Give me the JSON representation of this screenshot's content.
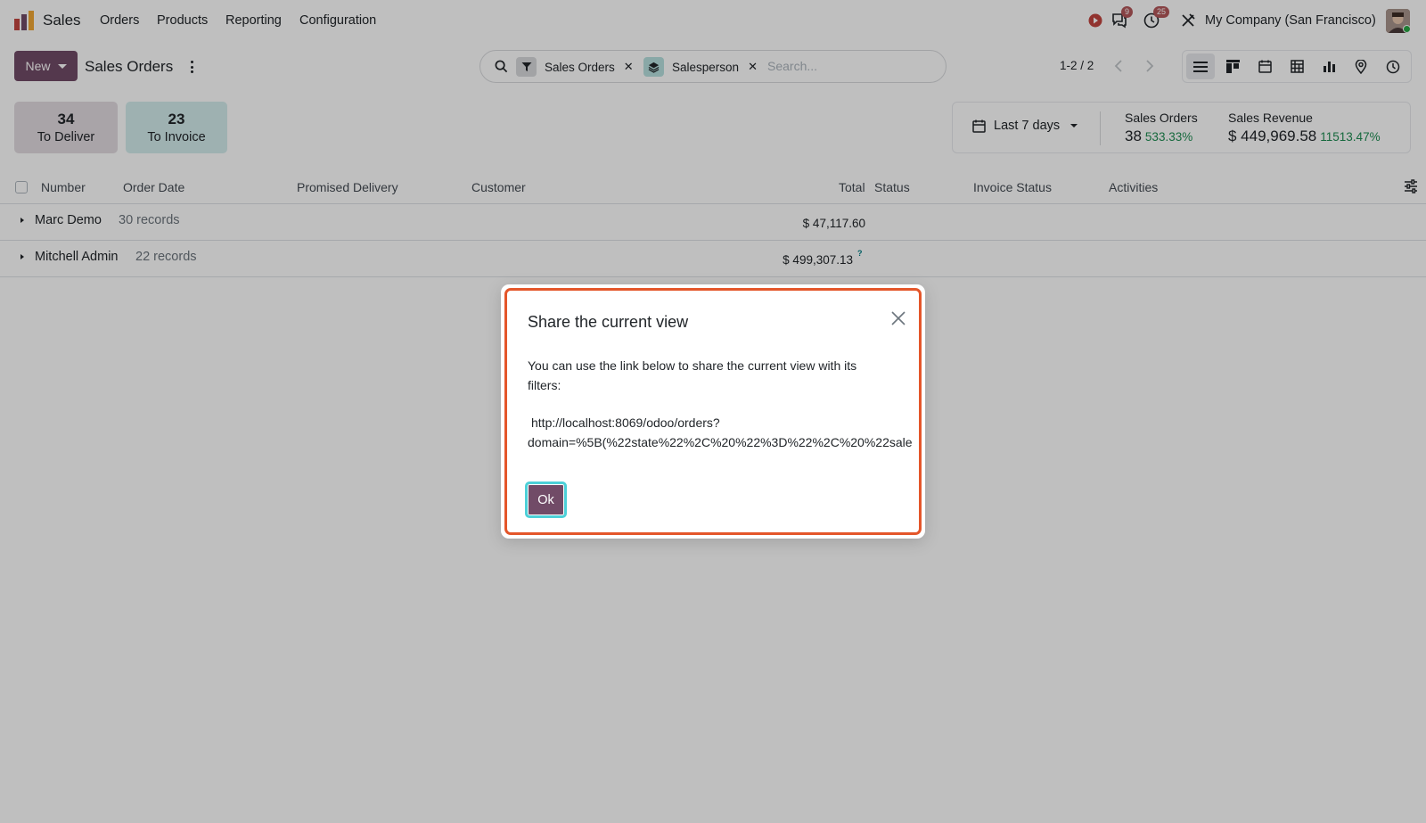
{
  "topbar": {
    "app_name": "Sales",
    "menu": [
      "Orders",
      "Products",
      "Reporting",
      "Configuration"
    ],
    "messages_badge": "9",
    "activities_badge": "25",
    "company": "My Company (San Francisco)"
  },
  "control_panel": {
    "new_label": "New",
    "title": "Sales Orders",
    "facets": [
      {
        "icon": "filter-icon",
        "label": "Sales Orders"
      },
      {
        "icon": "layers-icon",
        "label": "Salesperson"
      }
    ],
    "search_placeholder": "Search...",
    "pager": "1-2 / 2",
    "views": [
      "list-view-icon",
      "kanban-view-icon",
      "calendar-view-icon",
      "pivot-view-icon",
      "graph-view-icon",
      "map-view-icon",
      "activity-view-icon"
    ]
  },
  "tiles": [
    {
      "count": "34",
      "label": "To Deliver"
    },
    {
      "count": "23",
      "label": "To Invoice"
    }
  ],
  "kpis": {
    "period": "Last 7 days",
    "sales_orders_label": "Sales Orders",
    "sales_orders_value": "38",
    "sales_orders_delta": "533.33%",
    "revenue_label": "Sales Revenue",
    "revenue_value": "$ 449,969.58",
    "revenue_delta": "11513.47%"
  },
  "table": {
    "columns": [
      "Number",
      "Order Date",
      "Promised Delivery",
      "Customer",
      "Total",
      "Status",
      "Invoice Status",
      "Activities"
    ],
    "groups": [
      {
        "name": "Marc Demo",
        "count": "30 records",
        "total": "$ 47,117.60"
      },
      {
        "name": "Mitchell Admin",
        "count": "22 records",
        "total": "$ 499,307.13",
        "help": "?"
      }
    ]
  },
  "dialog": {
    "title": "Share the current view",
    "text": "You can use the link below to share the current view with its filters:",
    "link_line1": "http://localhost:8069/odoo/orders?",
    "link_line2": "domain=%5B(%22state%22%2C%20%22%3D%22%2C%20%22sale",
    "ok_label": "Ok"
  },
  "colors": {
    "brand": "#714b67",
    "accent": "#017e84",
    "positive": "#1e8c52",
    "dialog_border": "#e4562a"
  }
}
